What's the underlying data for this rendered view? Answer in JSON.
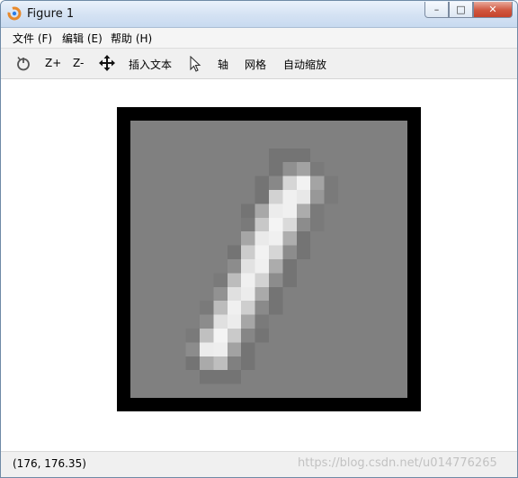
{
  "window": {
    "title": "Figure 1",
    "minimize_glyph": "–",
    "maximize_glyph": "□",
    "close_glyph": "✕"
  },
  "menu": {
    "items": [
      {
        "label": "文件 (F)"
      },
      {
        "label": "编辑 (E)"
      },
      {
        "label": "帮助 (H)"
      }
    ]
  },
  "toolbar": {
    "home_icon": "reset-view-icon",
    "zoom_in_label": "Z+",
    "zoom_out_label": "Z-",
    "pan_icon": "move-arrows-icon",
    "insert_text_label": "插入文本",
    "select_icon": "pointer-icon",
    "axes_label": "轴",
    "grid_label": "网格",
    "autoscale_label": "自动缩放"
  },
  "status": {
    "coords": "(176, 176.35)",
    "watermark": "https://blog.csdn.net/u014776265"
  },
  "chart_data": {
    "type": "heatmap",
    "colormap": "gray",
    "frame_color": "#000000",
    "background_gray": 128,
    "rows": [
      [
        128,
        128,
        128,
        128,
        128,
        128,
        128,
        128,
        128,
        128,
        128,
        128,
        128,
        128,
        128,
        128,
        128,
        128,
        128,
        128
      ],
      [
        128,
        128,
        128,
        128,
        128,
        128,
        128,
        128,
        128,
        128,
        128,
        128,
        128,
        128,
        128,
        128,
        128,
        128,
        128,
        128
      ],
      [
        128,
        128,
        128,
        128,
        128,
        128,
        128,
        128,
        128,
        128,
        116,
        116,
        116,
        128,
        128,
        128,
        128,
        128,
        128,
        128
      ],
      [
        128,
        128,
        128,
        128,
        128,
        128,
        128,
        128,
        128,
        128,
        116,
        144,
        162,
        122,
        128,
        128,
        128,
        128,
        128,
        128
      ],
      [
        128,
        128,
        128,
        128,
        128,
        128,
        128,
        128,
        128,
        116,
        136,
        214,
        242,
        164,
        122,
        128,
        128,
        128,
        128,
        128
      ],
      [
        128,
        128,
        128,
        128,
        128,
        128,
        128,
        128,
        128,
        116,
        210,
        240,
        232,
        152,
        122,
        128,
        128,
        128,
        128,
        128
      ],
      [
        128,
        128,
        128,
        128,
        128,
        128,
        128,
        128,
        116,
        168,
        236,
        240,
        172,
        122,
        128,
        128,
        128,
        128,
        128,
        128
      ],
      [
        128,
        128,
        128,
        128,
        128,
        128,
        128,
        128,
        122,
        200,
        244,
        218,
        140,
        122,
        128,
        128,
        128,
        128,
        128,
        128
      ],
      [
        128,
        128,
        128,
        128,
        128,
        128,
        128,
        128,
        166,
        234,
        240,
        174,
        116,
        128,
        128,
        128,
        128,
        128,
        128,
        128
      ],
      [
        128,
        128,
        128,
        128,
        128,
        128,
        128,
        116,
        204,
        242,
        214,
        140,
        116,
        128,
        128,
        128,
        128,
        128,
        128,
        128
      ],
      [
        128,
        128,
        128,
        128,
        128,
        128,
        128,
        140,
        226,
        240,
        172,
        116,
        128,
        128,
        128,
        128,
        128,
        128,
        128,
        128
      ],
      [
        128,
        128,
        128,
        128,
        128,
        128,
        122,
        188,
        240,
        210,
        140,
        116,
        128,
        128,
        128,
        128,
        128,
        128,
        128,
        128
      ],
      [
        128,
        128,
        128,
        128,
        128,
        128,
        146,
        224,
        236,
        170,
        116,
        128,
        128,
        128,
        128,
        128,
        128,
        128,
        128,
        128
      ],
      [
        128,
        128,
        128,
        128,
        128,
        122,
        188,
        240,
        206,
        138,
        116,
        128,
        128,
        128,
        128,
        128,
        128,
        128,
        128,
        128
      ],
      [
        128,
        128,
        128,
        128,
        128,
        140,
        224,
        236,
        166,
        122,
        128,
        128,
        128,
        128,
        128,
        128,
        128,
        128,
        128,
        128
      ],
      [
        128,
        128,
        128,
        128,
        122,
        192,
        244,
        202,
        134,
        116,
        128,
        128,
        128,
        128,
        128,
        128,
        128,
        128,
        128,
        128
      ],
      [
        128,
        128,
        128,
        128,
        140,
        236,
        238,
        162,
        116,
        128,
        128,
        128,
        128,
        128,
        128,
        128,
        128,
        128,
        128,
        128
      ],
      [
        128,
        128,
        128,
        128,
        116,
        170,
        190,
        128,
        116,
        128,
        128,
        128,
        128,
        128,
        128,
        128,
        128,
        128,
        128,
        128
      ],
      [
        128,
        128,
        128,
        128,
        128,
        116,
        116,
        116,
        128,
        128,
        128,
        128,
        128,
        128,
        128,
        128,
        128,
        128,
        128,
        128
      ],
      [
        128,
        128,
        128,
        128,
        128,
        128,
        128,
        128,
        128,
        128,
        128,
        128,
        128,
        128,
        128,
        128,
        128,
        128,
        128,
        128
      ]
    ]
  }
}
